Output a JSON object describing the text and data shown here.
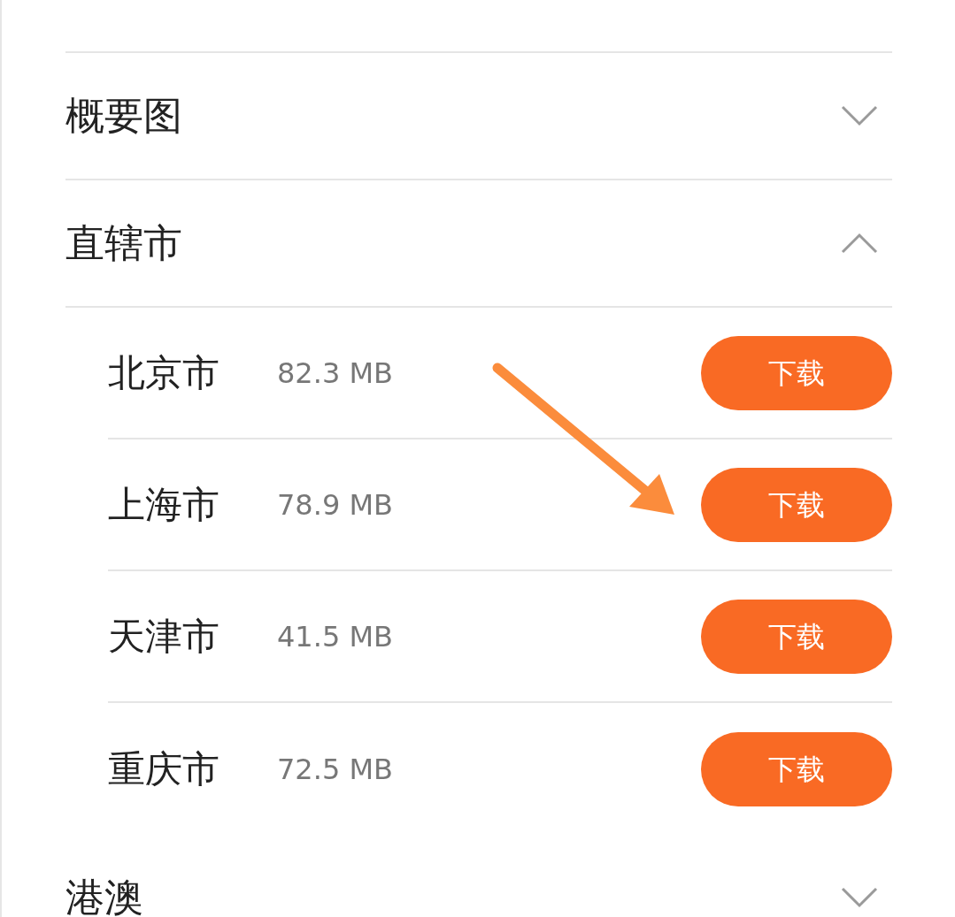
{
  "groups": [
    {
      "title": "概要图",
      "expanded": false
    },
    {
      "title": "直辖市",
      "expanded": true,
      "cities": [
        {
          "name": "北京市",
          "size": "82.3 MB",
          "button": "下载"
        },
        {
          "name": "上海市",
          "size": "78.9 MB",
          "button": "下载"
        },
        {
          "name": "天津市",
          "size": "41.5 MB",
          "button": "下载"
        },
        {
          "name": "重庆市",
          "size": "72.5 MB",
          "button": "下载"
        }
      ]
    },
    {
      "title": "港澳",
      "expanded": false
    }
  ]
}
